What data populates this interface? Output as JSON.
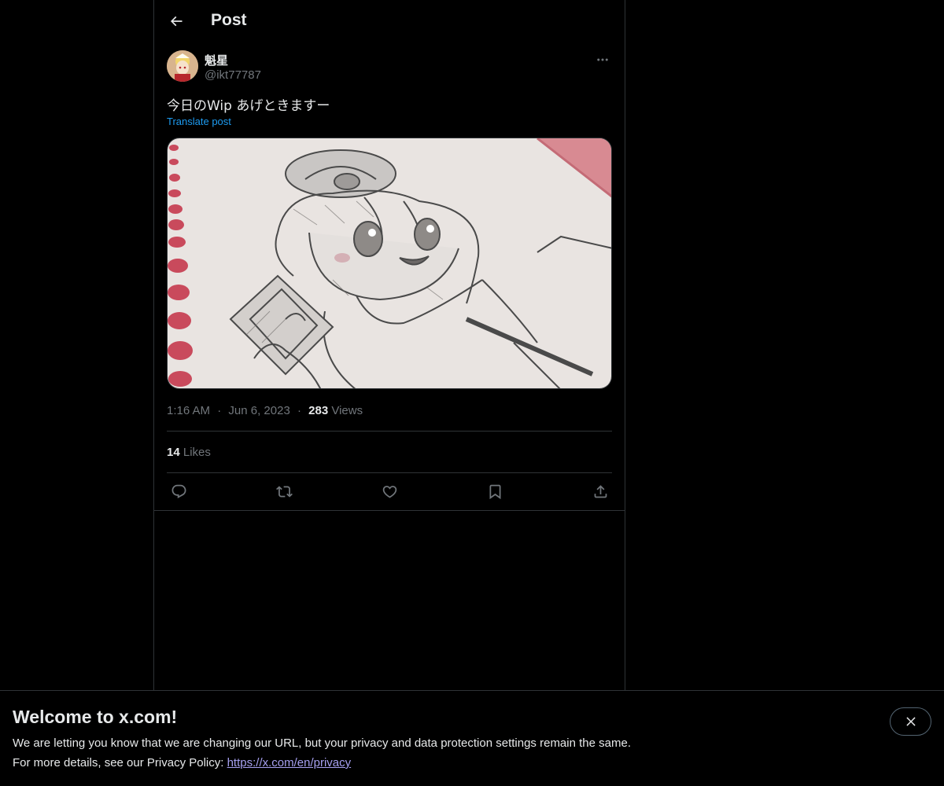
{
  "header": {
    "title": "Post",
    "back_icon": "arrow-left-icon"
  },
  "post": {
    "author": {
      "display_name": "魁星",
      "handle": "@ikt77787",
      "avatar_icon": "avatar"
    },
    "text": "今日のWip あげときますー",
    "translate_label": "Translate post",
    "media": {
      "alt": "pencil sketch of chibi character on spiral notebook"
    },
    "time": "1:16 AM",
    "date": "Jun 6, 2023",
    "separator": "·",
    "views_count": "283",
    "views_label": "Views",
    "likes_count": "14",
    "likes_label": "Likes",
    "actions": [
      {
        "name": "reply",
        "icon": "reply-icon"
      },
      {
        "name": "repost",
        "icon": "repost-icon"
      },
      {
        "name": "like",
        "icon": "heart-icon"
      },
      {
        "name": "bookmark",
        "icon": "bookmark-icon"
      },
      {
        "name": "share",
        "icon": "share-icon"
      }
    ]
  },
  "banner": {
    "title": "Welcome to x.com!",
    "line1": "We are letting you know that we are changing our URL, but your privacy and data protection settings remain the same.",
    "line2_prefix": "For more details, see our Privacy Policy: ",
    "link_text": "https://x.com/en/privacy"
  },
  "colors": {
    "background": "#000000",
    "text_primary": "#e7e9ea",
    "text_secondary": "#71767b",
    "accent": "#1d9bf0",
    "border": "#2f3336"
  }
}
